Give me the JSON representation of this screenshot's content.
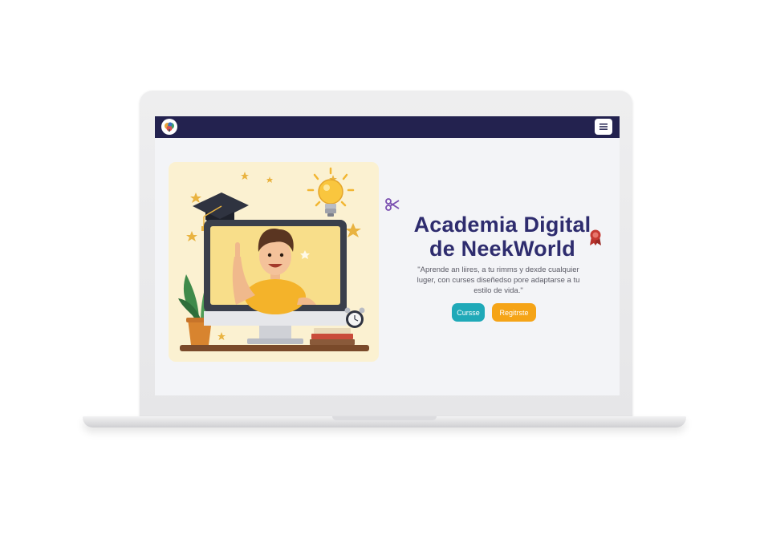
{
  "page": {
    "headline_line1": "Academia Digital",
    "headline_line2": "de NeekWorld",
    "subtitle": "\"Aprende an liires, a tu rimms y dexde cualquier luger, con curses diseñedso pore adaptarse a tu estilo de vida.\""
  },
  "navbar": {
    "logo_icon": "colorful-brain-logo-icon",
    "menu_icon": "hamburger-menu-icon"
  },
  "buttons": {
    "courses_label": "Cursse",
    "register_label": "Regitrste"
  },
  "illustration": {
    "subject": "boy-at-computer-illustration",
    "icons": [
      "graduation-cap-icon",
      "lightbulb-icon",
      "plant-icon",
      "alarm-clock-icon",
      "books-icon",
      "star-icon"
    ]
  },
  "colors": {
    "navbar": "#23224f",
    "headline": "#2e2c6e",
    "courses_button": "#1fa9b8",
    "register_button": "#f5a417",
    "hero_card": "#fbf1d1"
  }
}
